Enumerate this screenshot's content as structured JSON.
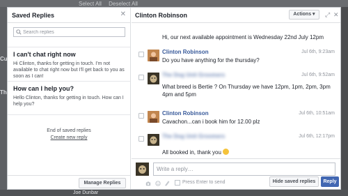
{
  "background": {
    "top_links": [
      "Select All",
      "Deselect All"
    ],
    "left_partial_texts": [
      "Cu",
      "Th"
    ],
    "bottom_text": "Joe Dunbar"
  },
  "saved_replies": {
    "title": "Saved Replies",
    "search_placeholder": "Search replies",
    "replies": [
      {
        "title": "I can't chat right now",
        "text": "Hi Clinton, thanks for getting in touch. I'm not available to chat right now but I'll get back to you as soon as I can!"
      },
      {
        "title": "How can I help you?",
        "text": "Hello Clinton, thanks for getting in touch. How can I help you?"
      }
    ],
    "end_text": "End of saved replies",
    "create_link": "Create new reply",
    "manage_button": "Manage Replies"
  },
  "conversation": {
    "title": "Clinton Robinson",
    "actions_label": "Actions",
    "messages": [
      {
        "text": "Hi, our next available appointment is Wednesday 22nd July 12pm"
      },
      {
        "sender": "Clinton Robinson",
        "time": "Jul 6th, 9:23am",
        "text": "Do you have anything for the thursday?"
      },
      {
        "sender": "The Dog Unit Groomers",
        "time": "Jul 6th, 9:52am",
        "text_lines": [
          "What breed is Bertie ?  On Thursday we have 12pm, 1pm, 2pm, 3pm",
          "4pm and 5pm"
        ]
      },
      {
        "sender": "Clinton Robinson",
        "time": "Jul 6th, 10:51am",
        "text": "Cavachon...can i book him for 12.00 plz"
      },
      {
        "sender": "The Dog Unit Groomers",
        "time": "Jul 6th, 12:17pm",
        "text": "All booked in, thank you"
      }
    ],
    "reply_placeholder": "Write a reply…",
    "enter_label": "Press Enter to send",
    "hide_button": "Hide saved replies",
    "reply_button": "Reply"
  },
  "colors": {
    "link": "#365899",
    "primary": "#4267b2",
    "overlay": "#4b4c4f"
  }
}
